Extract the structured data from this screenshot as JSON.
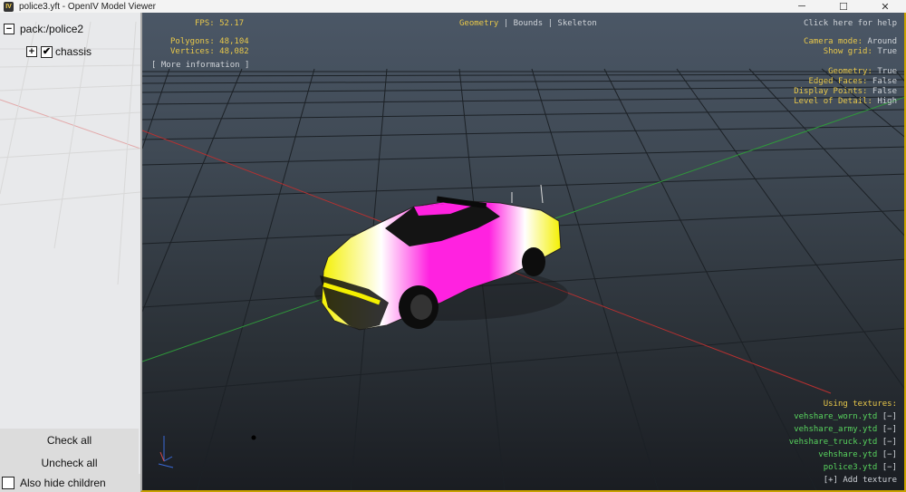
{
  "window": {
    "title": "police3.yft - OpenIV Model Viewer",
    "icon_label": "IV",
    "minimize": "─",
    "maximize": "☐",
    "close": "✕"
  },
  "tree": {
    "root": {
      "label": "pack:/police2",
      "expander": "−"
    },
    "child": {
      "label": "chassis",
      "expander": "+",
      "check": "✔"
    }
  },
  "buttons": {
    "check_all": "Check all",
    "uncheck_all": "Uncheck all",
    "also_hide_children": "Also hide children"
  },
  "hud": {
    "fps": "FPS: 52.17",
    "polygons": "Polygons: 48,104",
    "vertices": "Vertices: 48,082",
    "more_info": "[ More information ]",
    "help": "Click here for help",
    "tabs": [
      "Geometry",
      "Bounds",
      "Skeleton"
    ],
    "active_tab": "Geometry",
    "settings": [
      {
        "key": "Camera mode:",
        "value": "Around"
      },
      {
        "key": "Show grid:",
        "value": "True"
      },
      {
        "key": "Geometry:",
        "value": "True"
      },
      {
        "key": "Edged Faces:",
        "value": "False"
      },
      {
        "key": "Display Points:",
        "value": "False"
      },
      {
        "key": "Level of Detail:",
        "value": "High"
      }
    ],
    "textures_heading": "Using textures:",
    "textures": [
      {
        "name": "vehshare_worn.ytd",
        "action": "[−]"
      },
      {
        "name": "vehshare_army.ytd",
        "action": "[−]"
      },
      {
        "name": "vehshare_truck.ytd",
        "action": "[−]"
      },
      {
        "name": "vehshare.ytd",
        "action": "[−]"
      },
      {
        "name": "police3.ytd",
        "action": "[−]"
      }
    ],
    "add_texture": "[+] Add texture"
  },
  "colors": {
    "hud_yellow": "#e8c84a",
    "hud_green": "#58d45e",
    "grid_line": "#1e2328",
    "axis_red": "#b83030",
    "axis_green": "#2f9a3a",
    "car_magenta": "#ff22e0",
    "car_yellow": "#f4f000"
  }
}
